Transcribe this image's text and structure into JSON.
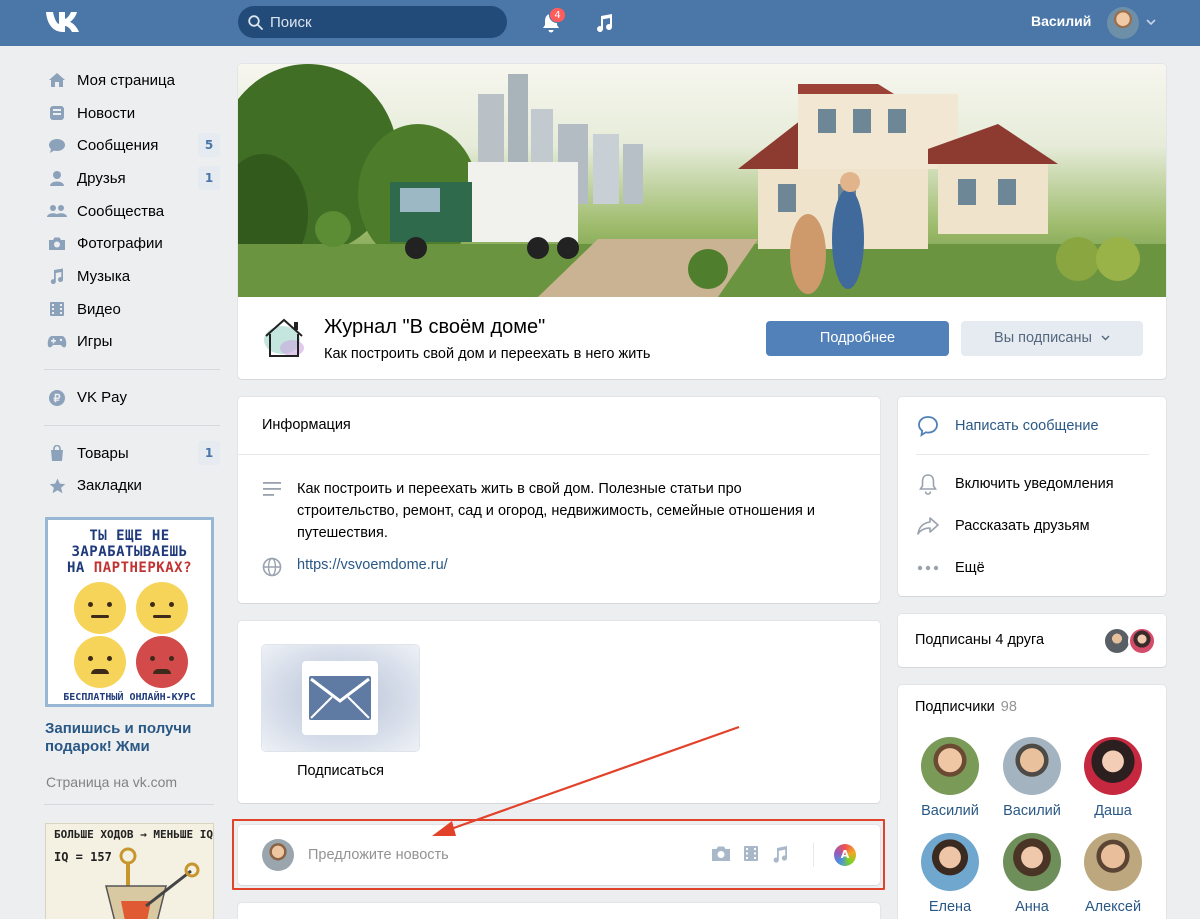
{
  "header": {
    "search_placeholder": "Поиск",
    "notifications_count": "4",
    "user_name": "Василий"
  },
  "sidebar": {
    "items": [
      {
        "label": "Моя страница",
        "icon": "home-icon"
      },
      {
        "label": "Новости",
        "icon": "news-icon"
      },
      {
        "label": "Сообщения",
        "icon": "messages-icon",
        "count": "5"
      },
      {
        "label": "Друзья",
        "icon": "friends-icon",
        "count": "1"
      },
      {
        "label": "Сообщества",
        "icon": "groups-icon"
      },
      {
        "label": "Фотографии",
        "icon": "camera-icon"
      },
      {
        "label": "Музыка",
        "icon": "music-icon"
      },
      {
        "label": "Видео",
        "icon": "video-icon"
      },
      {
        "label": "Игры",
        "icon": "gamepad-icon"
      },
      {
        "label": "VK Pay",
        "icon": "vkpay-icon"
      },
      {
        "label": "Товары",
        "icon": "bag-icon",
        "count": "1"
      },
      {
        "label": "Закладки",
        "icon": "star-icon"
      }
    ]
  },
  "ad": {
    "banner_line1": "ТЫ ЕЩЕ НЕ",
    "banner_line2": "ЗАРАБАТЫВАЕШЬ",
    "banner_line3_prefix": "НА ",
    "banner_line3_highlight": "ПАРТНЕРКАХ?",
    "banner_footer": "БЕСПЛАТНЫЙ ОНЛАЙН-КУРС",
    "text": "Запишись и получи подарок! Жми",
    "source": "Страница на vk.com",
    "ad2_title": "БОЛЬШЕ ХОДОВ → МЕНЬШЕ IQ",
    "ad2_sub": "IQ = 157"
  },
  "group": {
    "logo_text": "своем доме",
    "title": "Журнал \"В своём доме\"",
    "description": "Как построить свой дом и переехать в него жить",
    "more_button": "Подробнее",
    "subscribed_button": "Вы подписаны"
  },
  "info": {
    "heading": "Информация",
    "description": "Как построить и переехать жить в свой дом. Полезные статьи про строительство, ремонт, сад и огород, недвижимость, семейные отношения и путешествия.",
    "link": "https://vsvoemdome.ru/"
  },
  "subscribe": {
    "label": "Подписаться"
  },
  "suggest": {
    "placeholder": "Предложите новость"
  },
  "actions": {
    "write_message": "Написать сообщение",
    "enable_notifications": "Включить уведомления",
    "tell_friends": "Рассказать друзьям",
    "more": "Ещё"
  },
  "friends_subscribed": {
    "label": "Подписаны 4 друга"
  },
  "followers": {
    "heading": "Подписчики",
    "count": "98",
    "people": [
      {
        "name": "Василий"
      },
      {
        "name": "Василий"
      },
      {
        "name": "Даша"
      },
      {
        "name": "Елена"
      },
      {
        "name": "Анна"
      },
      {
        "name": "Алексей"
      }
    ]
  }
}
